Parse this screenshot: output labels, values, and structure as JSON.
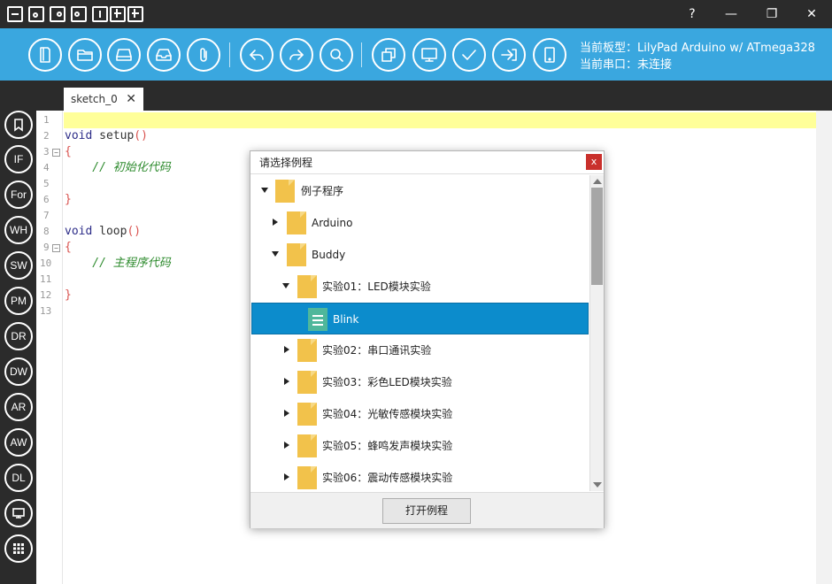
{
  "titlebar": {
    "help_label": "?",
    "minimize_label": "—",
    "restore_label": "❐",
    "close_label": "✕"
  },
  "toolbar": {
    "board_label": "当前板型：LilyPad Arduino w/ ATmega328",
    "port_label": "当前串口：未连接"
  },
  "sidebar": {
    "items": [
      "",
      "IF",
      "For",
      "WH",
      "SW",
      "PM",
      "DR",
      "DW",
      "AR",
      "AW",
      "DL",
      "",
      ""
    ]
  },
  "tabs": [
    {
      "label": "sketch_0",
      "close": "✕"
    }
  ],
  "editor": {
    "line_numbers": [
      "1",
      "2",
      "3",
      "4",
      "5",
      "6",
      "7",
      "8",
      "9",
      "10",
      "11",
      "12",
      "13"
    ],
    "lines": {
      "l2_kw": "void",
      "l2_fn": " setup",
      "l2_paren": "()",
      "l3": "{",
      "l4": "    // 初始化代码",
      "l6": "}",
      "l8_kw": "void",
      "l8_fn": " loop",
      "l8_paren": "()",
      "l9": "{",
      "l10": "    // 主程序代码",
      "l12": "}"
    }
  },
  "dialog": {
    "title": "请选择例程",
    "close_label": "x",
    "tree": [
      {
        "label": "例子程序",
        "state": "open"
      },
      {
        "label": "Arduino",
        "state": "closed"
      },
      {
        "label": "Buddy",
        "state": "open"
      },
      {
        "label": "实验01：LED模块实验",
        "state": "open"
      },
      {
        "label": "Blink",
        "state": "file"
      },
      {
        "label": "实验02：串口通讯实验",
        "state": "closed"
      },
      {
        "label": "实验03：彩色LED模块实验",
        "state": "closed"
      },
      {
        "label": "实验04：光敏传感模块实验",
        "state": "closed"
      },
      {
        "label": "实验05：蜂鸣发声模块实验",
        "state": "closed"
      },
      {
        "label": "实验06：震动传感模块实验",
        "state": "closed"
      }
    ],
    "open_button": "打开例程"
  },
  "colors": {
    "toolbar": "#3aa7df",
    "selection": "#0c8ccc",
    "folder": "#f2c24b",
    "file": "#4fb79b"
  }
}
